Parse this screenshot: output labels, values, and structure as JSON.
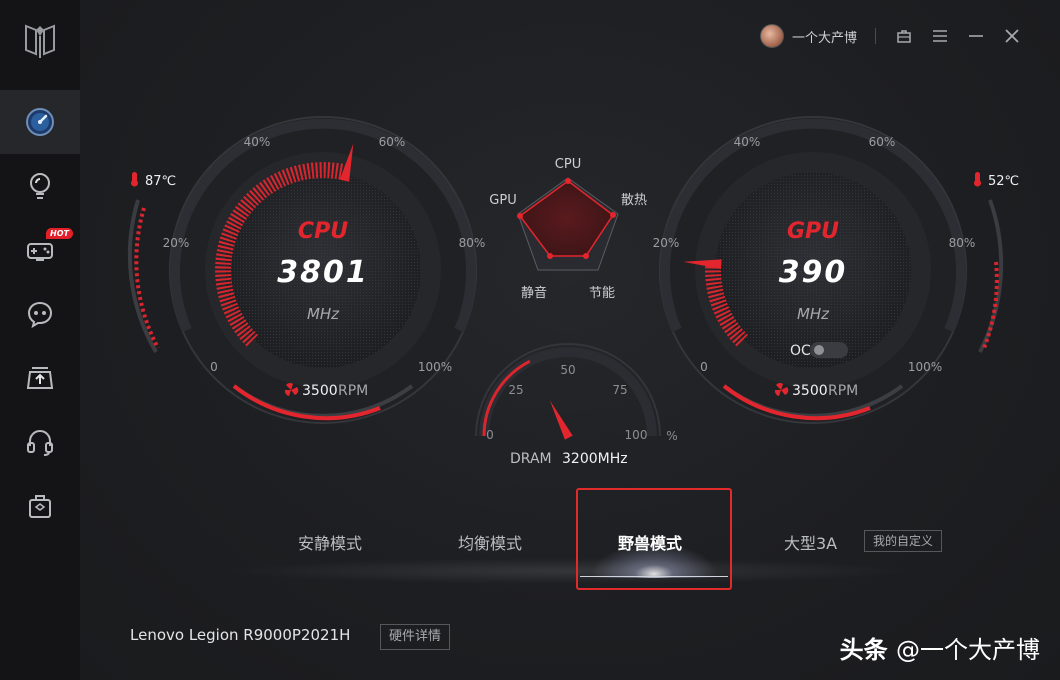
{
  "user": {
    "name": "一个大产博"
  },
  "sidebar": {
    "items": [
      {
        "icon": "dashboard-icon",
        "active": true
      },
      {
        "icon": "lightbulb-icon"
      },
      {
        "icon": "gamepad-icon",
        "badge": "HOT"
      },
      {
        "icon": "chat-bubble-icon"
      },
      {
        "icon": "upload-icon"
      },
      {
        "icon": "headset-icon"
      },
      {
        "icon": "toolbox-icon"
      }
    ]
  },
  "cpu": {
    "title": "CPU",
    "value": "3801",
    "unit": "MHz",
    "temp": "87℃",
    "fan": "3500",
    "fan_unit": "RPM",
    "ticks": [
      "0",
      "20%",
      "40%",
      "60%",
      "80%",
      "100%"
    ],
    "load_fraction": 0.55
  },
  "gpu": {
    "title": "GPU",
    "value": "390",
    "unit": "MHz",
    "temp": "52℃",
    "fan": "3500",
    "fan_unit": "RPM",
    "oc_label": "OC",
    "oc_enabled": false,
    "ticks": [
      "0",
      "20%",
      "40%",
      "60%",
      "80%",
      "100%"
    ],
    "load_fraction": 0.18
  },
  "radar": {
    "labels": [
      "CPU",
      "散热",
      "节能",
      "静音",
      "GPU"
    ]
  },
  "dram": {
    "label": "DRAM",
    "value": "3200MHz",
    "ticks": [
      "0",
      "25",
      "50",
      "75",
      "100"
    ],
    "unit": "%",
    "usage_fraction": 0.35
  },
  "modes": {
    "items": [
      "安静模式",
      "均衡模式",
      "野兽模式",
      "大型3A"
    ],
    "active": "野兽模式",
    "custom_label": "我的自定义"
  },
  "device": {
    "name": "Lenovo Legion R9000P2021H",
    "details_label": "硬件详情"
  },
  "watermark": {
    "source": "头条",
    "handle": "@一个大产博"
  },
  "colors": {
    "accent": "#e3262d",
    "background": "#1e1f22",
    "sidebar": "#141416"
  }
}
